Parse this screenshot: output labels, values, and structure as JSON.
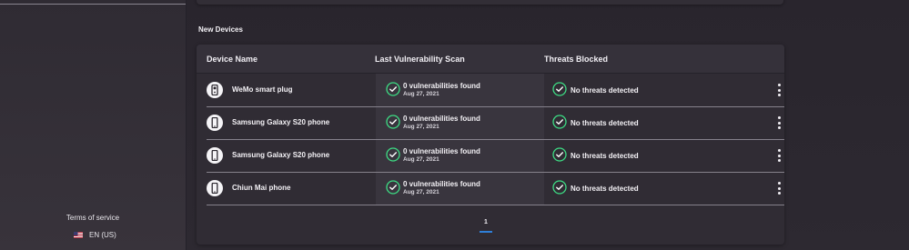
{
  "sidebar": {
    "terms_label": "Terms of service",
    "language_label": "EN (US)"
  },
  "section": {
    "title": "New Devices"
  },
  "table": {
    "columns": [
      "Device Name",
      "Last Vulnerability Scan",
      "Threats Blocked"
    ],
    "rows": [
      {
        "device": "WeMo smart plug",
        "device_icon": "smart-plug-icon",
        "scan_result": "0 vulnerabilities found",
        "scan_date": "Aug 27, 2021",
        "threats": "No threats detected"
      },
      {
        "device": "Samsung Galaxy S20 phone",
        "device_icon": "phone-icon",
        "scan_result": "0 vulnerabilities found",
        "scan_date": "Aug 27, 2021",
        "threats": "No threats detected"
      },
      {
        "device": "Samsung Galaxy S20 phone",
        "device_icon": "phone-icon",
        "scan_result": "0 vulnerabilities found",
        "scan_date": "Aug 27, 2021",
        "threats": "No threats detected"
      },
      {
        "device": "Chiun Mai phone",
        "device_icon": "phone-icon",
        "scan_result": "0 vulnerabilities found",
        "scan_date": "Aug 27, 2021",
        "threats": "No threats detected"
      }
    ]
  },
  "pagination": {
    "current_page": "1"
  },
  "colors": {
    "check_green": "#3ddc84",
    "page_accent": "#2f7fd8"
  }
}
